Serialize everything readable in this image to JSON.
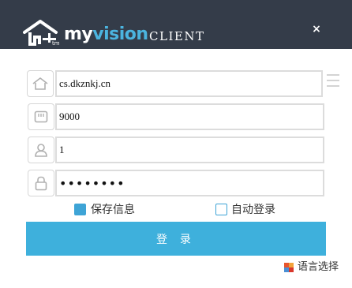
{
  "header": {
    "brand_my": "my",
    "brand_vision": "vision",
    "brand_client": "CLIENT",
    "close_label": "×"
  },
  "form": {
    "server": "cs.dkznkj.cn",
    "port": "9000",
    "username": "1",
    "password": "••••••••"
  },
  "options": {
    "save_info_label": "保存信息",
    "save_info_checked": true,
    "auto_login_label": "自动登录",
    "auto_login_checked": false
  },
  "login_label": "登 录",
  "language_label": "语言选择",
  "icons": {
    "logo": "house-logo-icon",
    "server": "home-icon",
    "port": "port-icon",
    "user": "user-icon",
    "password": "lock-icon",
    "menu": "menu-icon",
    "language": "language-flag-icon"
  },
  "colors": {
    "header_bg": "#343c49",
    "accent": "#3eb0dc",
    "brand_vision": "#4bb4df"
  }
}
